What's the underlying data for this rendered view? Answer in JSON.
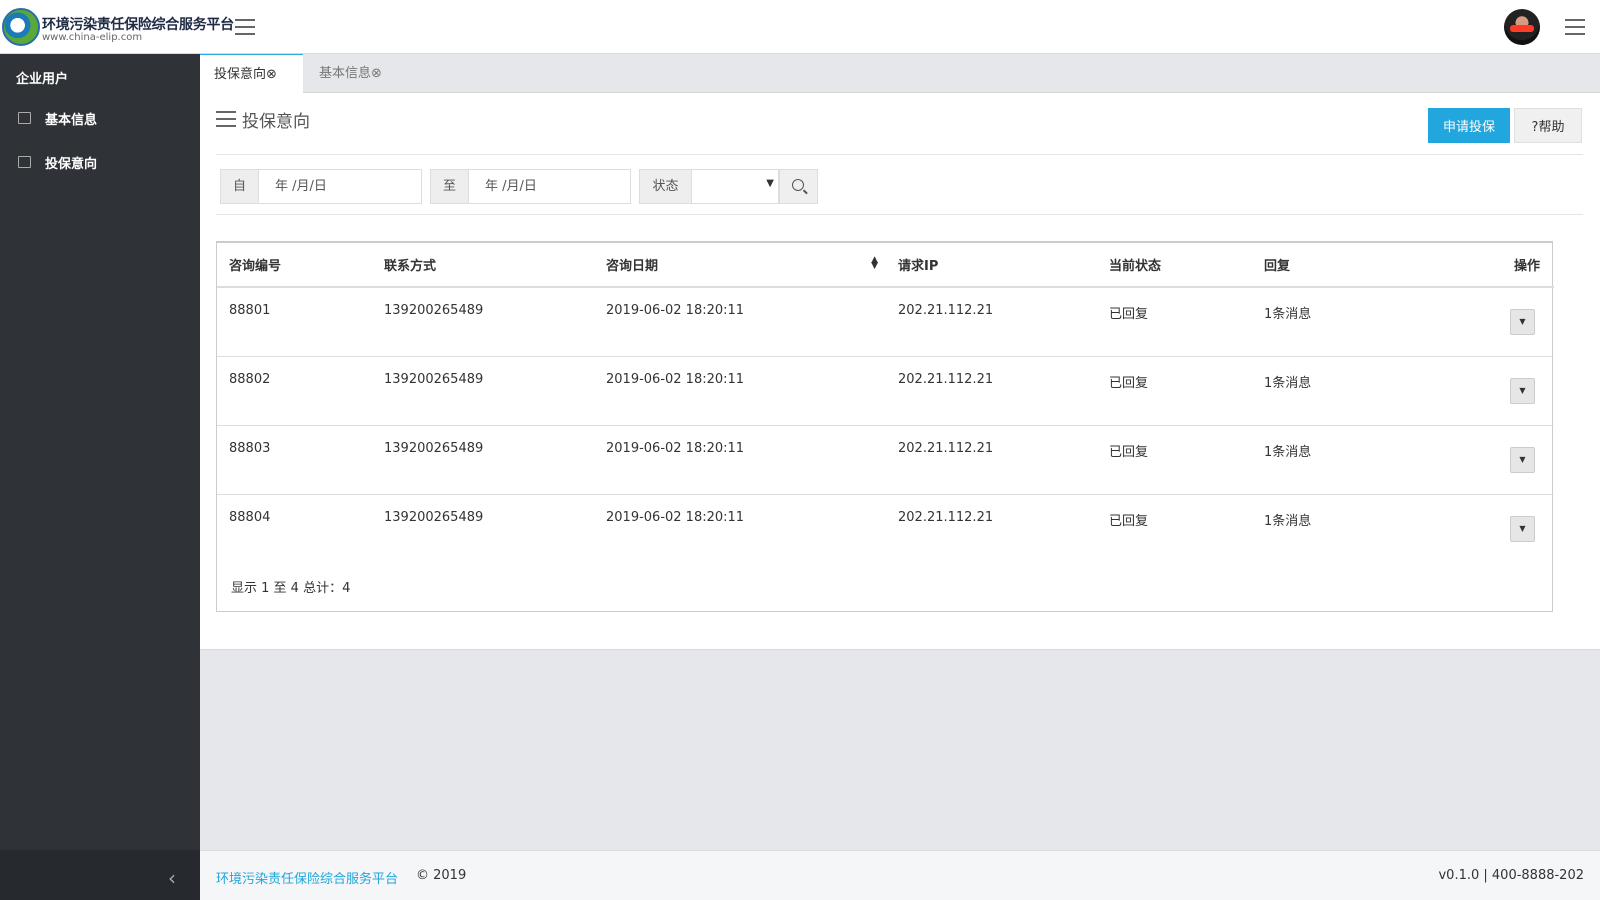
{
  "header": {
    "brand": "环境污染责任保险综合服务平台",
    "url": "www.china-elip.com"
  },
  "sidebar": {
    "title": "企业用户",
    "items": [
      {
        "label": "基本信息"
      },
      {
        "label": "投保意向"
      }
    ]
  },
  "tabs": [
    {
      "label": "投保意向⊗"
    },
    {
      "label": "基本信息⊗"
    }
  ],
  "main": {
    "title": "投保意向",
    "apply_label": "申请投保",
    "help_label": "?帮助"
  },
  "filters": {
    "from_label": "自",
    "to_label": "至",
    "from_placeholder": "年 /月/日",
    "to_placeholder": "年 /月/日",
    "status_label": "状态",
    "status_value": ""
  },
  "table": {
    "columns": [
      "咨询编号",
      "联系方式",
      "咨询日期",
      "请求IP",
      "当前状态",
      "回复",
      "操作"
    ],
    "rows": [
      {
        "id": "88801",
        "contact": "139200265489",
        "date": "2019-06-02 18:20:11",
        "ip": "202.21.112.21",
        "status": "已回复",
        "reply": "1条消息"
      },
      {
        "id": "88802",
        "contact": "139200265489",
        "date": "2019-06-02 18:20:11",
        "ip": "202.21.112.21",
        "status": "已回复",
        "reply": "1条消息"
      },
      {
        "id": "88803",
        "contact": "139200265489",
        "date": "2019-06-02 18:20:11",
        "ip": "202.21.112.21",
        "status": "已回复",
        "reply": "1条消息"
      },
      {
        "id": "88804",
        "contact": "139200265489",
        "date": "2019-06-02 18:20:11",
        "ip": "202.21.112.21",
        "status": "已回复",
        "reply": "1条消息"
      }
    ],
    "pager_text": "显示 1 至 4 总计：4"
  },
  "footer": {
    "brand": "环境污染责任保险综合服务平台",
    "copyright": "© 2019",
    "version": "v0.1.0 |  400-8888-202"
  },
  "colors": {
    "accent": "#21a6dd",
    "sidebar": "#2f3237",
    "sidebar_dark": "#26292e"
  },
  "icons": [
    "logo-icon",
    "menu-icon",
    "avatar",
    "book-icon",
    "document-icon",
    "close-circle-icon",
    "list-icon",
    "question-icon",
    "chevron-down-icon",
    "search-icon",
    "sort-icon",
    "caret-down-icon",
    "chevron-left-icon"
  ]
}
